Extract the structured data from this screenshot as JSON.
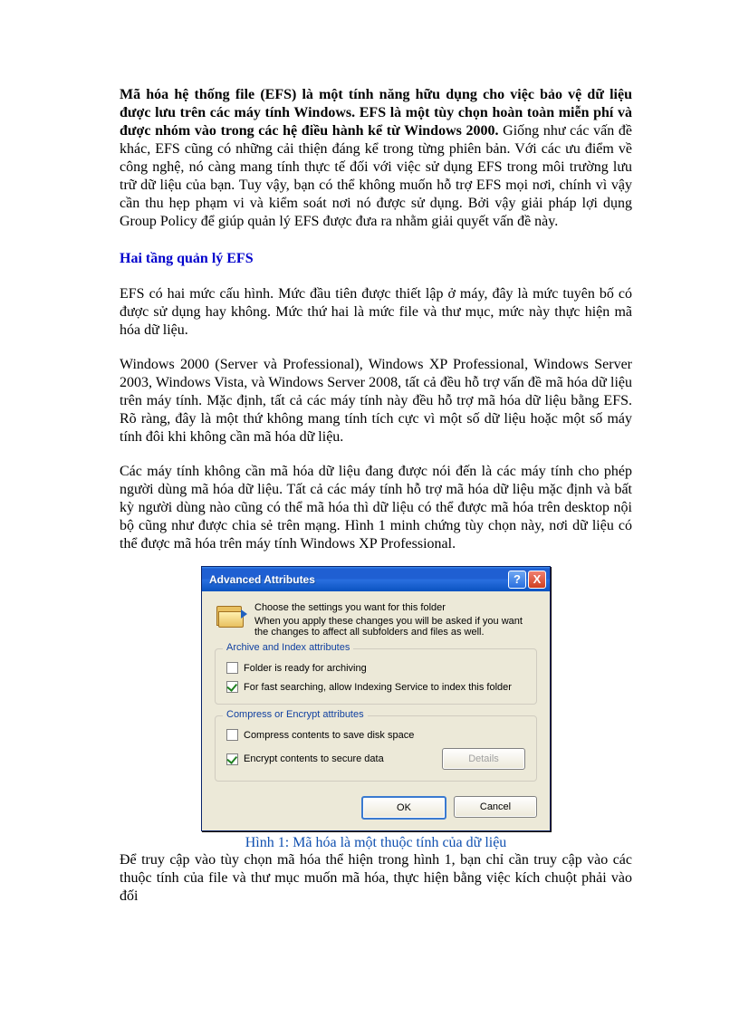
{
  "intro": {
    "bold": "Mã hóa hệ thống file (EFS) là một tính năng hữu dụng cho việc bảo vệ dữ liệu được lưu trên các máy tính Windows. EFS là một tùy chọn hoàn toàn miễn phí và được nhóm vào trong các hệ điều hành kể từ Windows 2000.",
    "rest": " Giống như các vấn đề khác, EFS cũng có những cải thiện đáng kể trong từng phiên bản. Với các ưu điểm về công nghệ, nó càng mang tính thực tế đối với việc sử dụng EFS trong môi trường lưu trữ dữ liệu của bạn. Tuy vậy, bạn có thể không muốn hỗ trợ EFS mọi nơi, chính vì vậy cần thu hẹp phạm vi và kiểm soát nơi nó được sử dụng. Bởi vậy giải pháp lợi dụng Group Policy để giúp quản lý EFS được đưa ra nhằm giải quyết vấn đề này."
  },
  "heading1": "Hai tầng quản lý EFS",
  "para1": "EFS có hai mức cấu hình. Mức đầu tiên được thiết lập ở máy, đây là mức tuyên bố có được sử dụng hay không. Mức thứ hai là mức file và thư mục, mức này thực hiện mã hóa dữ liệu.",
  "para2": "Windows 2000 (Server và Professional), Windows XP Professional, Windows Server 2003, Windows Vista, và Windows Server 2008, tất cả đều hỗ trợ vấn đề mã hóa dữ liệu trên máy tính. Mặc định, tất cả các máy tính này đều hỗ trợ mã hóa dữ liệu bằng EFS. Rõ ràng, đây là một thứ không mang tính tích cực vì một số dữ liệu hoặc một số máy tính đôi khi không cần mã hóa dữ liệu.",
  "para3": "Các máy tính không cần mã hóa dữ liệu đang được nói đến là các máy tính cho phép người dùng mã hóa dữ liệu. Tất cả các máy tính hỗ trợ mã hóa dữ liệu mặc định và bất kỳ người dùng nào cũng có thể mã hóa thì dữ liệu có thể được mã hóa trên desktop nội bộ cũng như được chia sẻ trên mạng. Hình 1 minh chứng tùy chọn này, nơi dữ liệu có thể được mã hóa trên máy tính Windows XP Professional.",
  "dialog": {
    "title": "Advanced Attributes",
    "help": "?",
    "close": "X",
    "header_line1": "Choose the settings you want for this folder",
    "header_line2": "When you apply these changes you will be asked if you want the changes to affect all subfolders and files as well.",
    "fieldset1": {
      "legend": "Archive and Index attributes",
      "check1": {
        "label": "Folder is ready for archiving",
        "checked": false
      },
      "check2": {
        "label": "For fast searching, allow Indexing Service to index this folder",
        "checked": true
      }
    },
    "fieldset2": {
      "legend": "Compress or Encrypt attributes",
      "check1": {
        "label": "Compress contents to save disk space",
        "checked": false
      },
      "check2": {
        "label": "Encrypt contents to secure data",
        "checked": true
      },
      "details_btn": "Details"
    },
    "ok_btn": "OK",
    "cancel_btn": "Cancel"
  },
  "caption": "Hình 1: Mã hóa là một thuộc tính của dữ liệu",
  "para4": "Để truy cập vào tùy chọn mã hóa thể hiện trong hình 1, bạn chỉ cần truy cập vào các thuộc tính của file và thư mục muốn mã hóa, thực hiện bằng việc kích chuột phải vào đối"
}
